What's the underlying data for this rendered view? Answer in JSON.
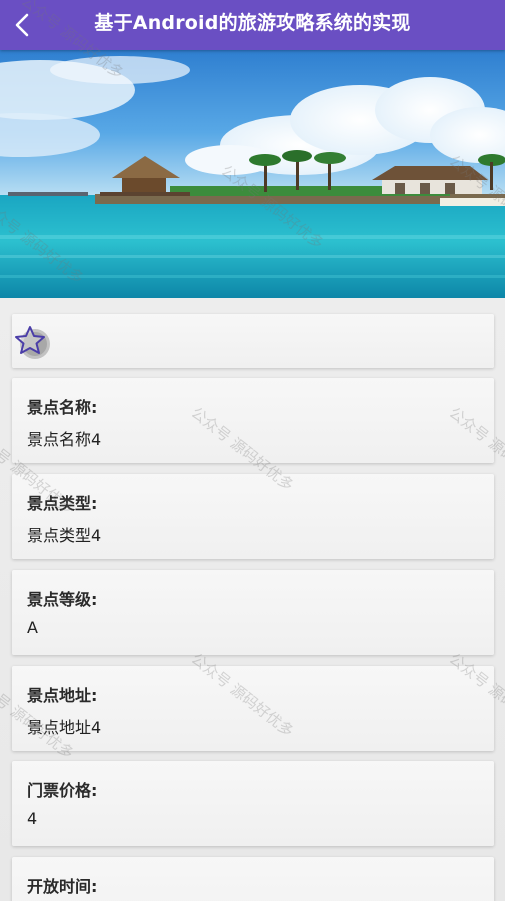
{
  "app_bar": {
    "title": "基于Android的旅游攻略系统的实现",
    "back_icon": "chevron-left-icon",
    "background": "#6a4fc3"
  },
  "hero": {
    "image": "tropical-island-beach-photo"
  },
  "favorite": {
    "icon": "star-outline-icon",
    "accent": "#4b3ea8"
  },
  "fields": [
    {
      "label": "景点名称:",
      "value": "景点名称4"
    },
    {
      "label": "景点类型:",
      "value": "景点类型4"
    },
    {
      "label": "景点等级:",
      "value": "A"
    },
    {
      "label": "景点地址:",
      "value": "景点地址4"
    },
    {
      "label": "门票价格:",
      "value": "4"
    },
    {
      "label": "开放时间:",
      "value": ""
    }
  ],
  "watermark": {
    "text": "公众号 源码好优多"
  }
}
